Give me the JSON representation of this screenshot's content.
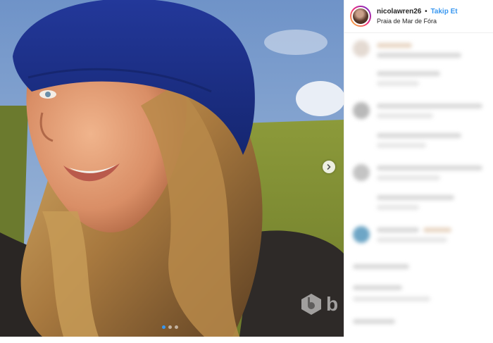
{
  "post": {
    "username": "nicolawren26",
    "separator": "•",
    "follow_label": "Takip Et",
    "location": "Praia de Mar de Fóra",
    "carousel": {
      "slides": 3,
      "active": 1
    }
  },
  "watermark": {
    "text": "b"
  },
  "colors": {
    "accent": "#3897f0",
    "hat": "#1c2f8a",
    "sky": "#7a9ccf",
    "grass": "#8a9b3c"
  },
  "icons": [
    "chevron-right-icon",
    "watermark-logo-icon"
  ]
}
